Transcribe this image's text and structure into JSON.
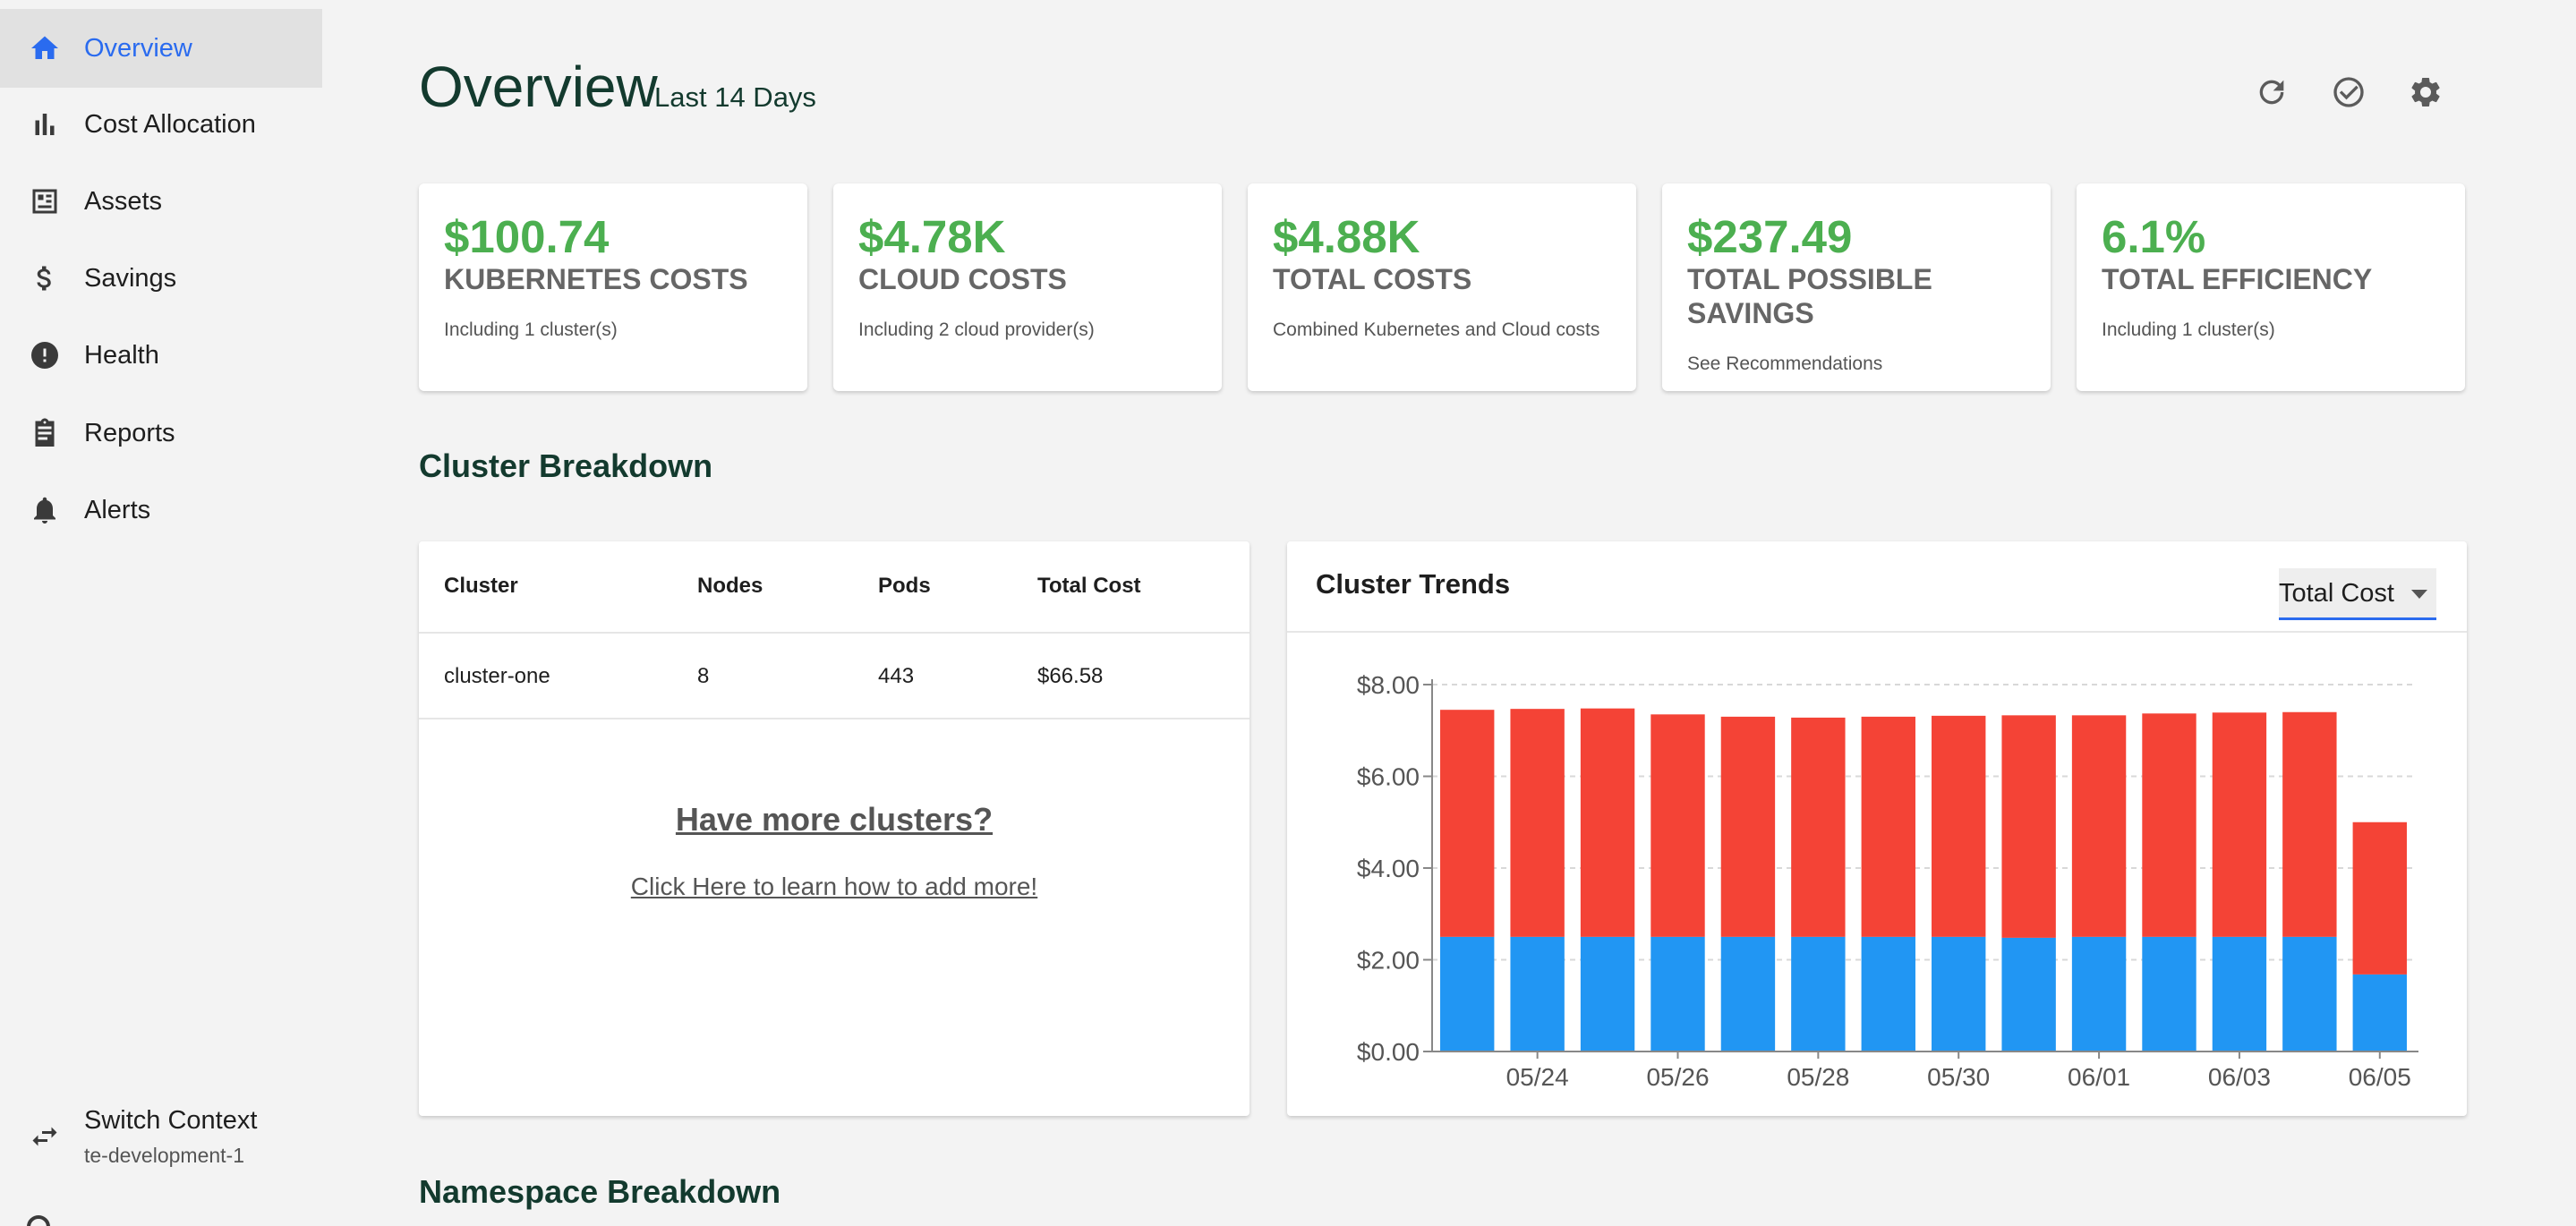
{
  "sidebar": {
    "items": [
      {
        "label": "Overview",
        "icon": "home-icon",
        "active": true
      },
      {
        "label": "Cost Allocation",
        "icon": "bar-chart-icon"
      },
      {
        "label": "Assets",
        "icon": "assets-icon"
      },
      {
        "label": "Savings",
        "icon": "dollar-icon"
      },
      {
        "label": "Health",
        "icon": "alert-circle-icon"
      },
      {
        "label": "Reports",
        "icon": "clipboard-icon"
      },
      {
        "label": "Alerts",
        "icon": "bell-icon"
      }
    ],
    "context": {
      "title": "Switch Context",
      "subtitle": "te-development-1",
      "icon": "swap-icon"
    }
  },
  "header": {
    "title": "Overview",
    "subtitle": "Last 14 Days",
    "actions": [
      "refresh-icon",
      "check-circle-icon",
      "gear-icon"
    ]
  },
  "cards": [
    {
      "value": "$100.74",
      "label": "KUBERNETES COSTS",
      "note": "Including 1 cluster(s)"
    },
    {
      "value": "$4.78K",
      "label": "CLOUD COSTS",
      "note": "Including 2 cloud provider(s)"
    },
    {
      "value": "$4.88K",
      "label": "TOTAL COSTS",
      "note": "Combined Kubernetes and Cloud costs"
    },
    {
      "value": "$237.49",
      "label": "TOTAL POSSIBLE SAVINGS",
      "note": "See Recommendations"
    },
    {
      "value": "6.1%",
      "label": "TOTAL EFFICIENCY",
      "note": "Including 1 cluster(s)"
    }
  ],
  "cluster_breakdown": {
    "title": "Cluster Breakdown",
    "table": {
      "headers": [
        "Cluster",
        "Nodes",
        "Pods",
        "Total Cost"
      ],
      "rows": [
        [
          "cluster-one",
          "8",
          "443",
          "$66.58"
        ]
      ]
    },
    "more_title": "Have more clusters?",
    "more_link": "Click Here to learn how to add more!"
  },
  "cluster_trends": {
    "title": "Cluster Trends",
    "select_value": "Total Cost"
  },
  "namespace_breakdown": {
    "title": "Namespace Breakdown"
  },
  "colors": {
    "accent": "#2a6bef",
    "green": "#4caf50",
    "red": "#f44336",
    "blue": "#2196f3",
    "title": "#133a2e"
  },
  "chart_data": {
    "type": "bar",
    "stacked": true,
    "title": "",
    "xlabel": "",
    "ylabel": "",
    "categories": [
      "05/23",
      "05/24",
      "05/25",
      "05/26",
      "05/27",
      "05/28",
      "05/29",
      "05/30",
      "05/31",
      "06/01",
      "06/02",
      "06/03",
      "06/04",
      "06/05"
    ],
    "x_tick_labels": [
      "05/24",
      "05/26",
      "05/28",
      "05/30",
      "06/01",
      "06/03",
      "06/05"
    ],
    "series": [
      {
        "color": "#2196f3",
        "values": [
          2.5,
          2.5,
          2.5,
          2.5,
          2.5,
          2.5,
          2.5,
          2.5,
          2.48,
          2.5,
          2.5,
          2.5,
          2.5,
          1.68
        ]
      },
      {
        "color": "#f44336",
        "values": [
          4.95,
          4.97,
          4.98,
          4.85,
          4.8,
          4.78,
          4.8,
          4.82,
          4.85,
          4.83,
          4.87,
          4.89,
          4.9,
          3.32
        ]
      }
    ],
    "ylim": [
      0,
      8
    ],
    "y_ticks": [
      "$0.00",
      "$2.00",
      "$4.00",
      "$6.00",
      "$8.00"
    ],
    "grid": true
  }
}
